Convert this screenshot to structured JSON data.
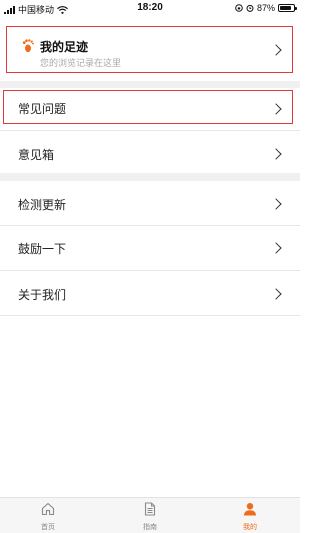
{
  "status_bar": {
    "carrier": "中国移动",
    "time": "18:20",
    "battery": "87%",
    "battery_level": 0.87
  },
  "footprint": {
    "title": "我的足迹",
    "subtitle": "您的浏览记录在这里",
    "icon": "footprints-icon"
  },
  "menu": [
    {
      "label": "常见问题"
    },
    {
      "label": "意见箱"
    },
    {
      "label": "检测更新"
    },
    {
      "label": "鼓励一下"
    },
    {
      "label": "关于我们"
    }
  ],
  "tabs": [
    {
      "label": "首页",
      "icon": "home-icon",
      "active": false
    },
    {
      "label": "指南",
      "icon": "document-icon",
      "active": false
    },
    {
      "label": "我的",
      "icon": "user-icon",
      "active": true
    }
  ],
  "colors": {
    "accent": "#ef6c1b",
    "highlight_border": "#e23a3a",
    "section_gap": "#f0f0f0"
  }
}
